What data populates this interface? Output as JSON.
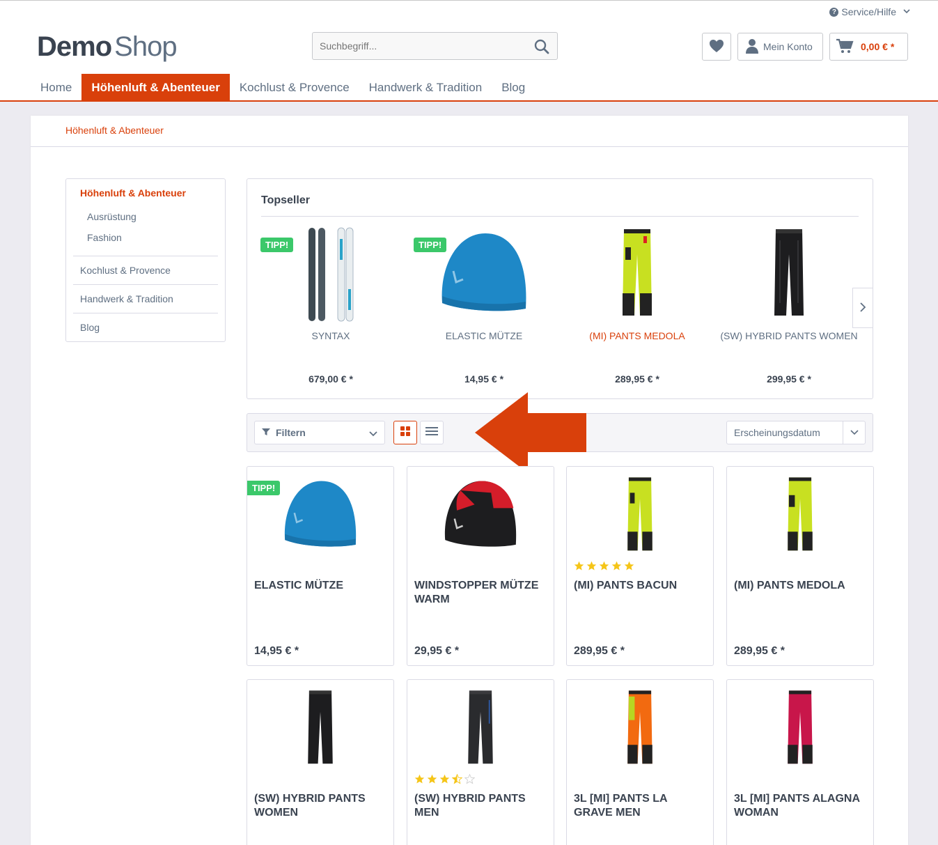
{
  "header": {
    "service_label": "Service/Hilfe",
    "logo_bold": "Demo",
    "logo_light": "Shop",
    "search_placeholder": "Suchbegriff...",
    "account_label": "Mein Konto",
    "cart_amount": "0,00 € *"
  },
  "nav": {
    "items": [
      "Home",
      "Höhenluft & Abenteuer",
      "Kochlust & Provence",
      "Handwerk & Tradition",
      "Blog"
    ],
    "active_index": 1
  },
  "breadcrumb": "Höhenluft & Abenteuer",
  "sidebar": {
    "current": "Höhenluft & Abenteuer",
    "subitems": [
      "Ausrüstung",
      "Fashion"
    ],
    "items": [
      "Kochlust & Provence",
      "Handwerk & Tradition",
      "Blog"
    ]
  },
  "topseller": {
    "title": "Topseller",
    "products": [
      {
        "name": "SYNTAX",
        "price": "679,00 € *",
        "badge": "TIPP!",
        "icon": "ski-icon"
      },
      {
        "name": "ELASTIC MÜTZE",
        "price": "14,95 € *",
        "badge": "TIPP!",
        "icon": "beanie-blue-icon"
      },
      {
        "name": "(MI) PANTS MEDOLA",
        "price": "289,95 € *",
        "badge": "",
        "icon": "pants-yellow-icon",
        "highlight": true
      },
      {
        "name": "(SW) HYBRID PANTS WOMEN",
        "price": "299,95 € *",
        "badge": "",
        "icon": "pants-black-icon"
      }
    ]
  },
  "toolbar": {
    "filter_label": "Filtern",
    "sort_label": "Erscheinungsdatum"
  },
  "products": [
    {
      "name": "ELASTIC MÜTZE",
      "price": "14,95 € *",
      "badge": "TIPP!",
      "rating": null,
      "icon": "beanie-blue-icon"
    },
    {
      "name": "WINDSTOPPER MÜTZE WARM",
      "price": "29,95 € *",
      "badge": "",
      "rating": null,
      "icon": "beanie-red-black-icon"
    },
    {
      "name": "(MI) PANTS BACUN",
      "price": "289,95 € *",
      "badge": "",
      "rating": 5,
      "icon": "pants-yellow-icon"
    },
    {
      "name": "(MI) PANTS MEDOLA",
      "price": "289,95 € *",
      "badge": "",
      "rating": null,
      "icon": "pants-yellow-icon"
    },
    {
      "name": "(SW) HYBRID PANTS WOMEN",
      "price": "",
      "badge": "",
      "rating": null,
      "icon": "pants-black-icon"
    },
    {
      "name": "(SW) HYBRID PANTS MEN",
      "price": "",
      "badge": "",
      "rating": 3.5,
      "icon": "pants-black-icon"
    },
    {
      "name": "3L [MI] PANTS LA GRAVE MEN",
      "price": "",
      "badge": "",
      "rating": null,
      "icon": "pants-orange-icon"
    },
    {
      "name": "3L [MI] PANTS ALAGNA WOMAN",
      "price": "",
      "badge": "",
      "rating": null,
      "icon": "pants-pink-icon"
    }
  ],
  "colors": {
    "accent": "#d9400b",
    "badge": "#3bc86a",
    "text": "#5f6f82",
    "heading": "#3a4350",
    "star": "#f5c518"
  }
}
